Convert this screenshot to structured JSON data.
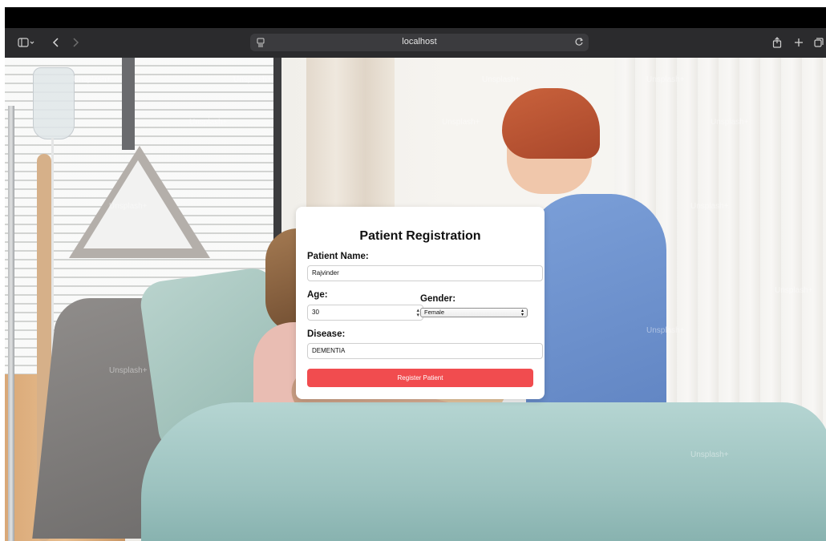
{
  "browser": {
    "url": "localhost",
    "icons": {
      "sidebar": "sidebar-icon",
      "back": "chevron-left-icon",
      "forward": "chevron-right-icon",
      "reload": "reload-icon",
      "share": "share-icon",
      "new_tab": "plus-icon",
      "tabs": "tabs-overview-icon"
    }
  },
  "background": {
    "watermark_text": "Unsplash+"
  },
  "form": {
    "title": "Patient Registration",
    "patient_name": {
      "label": "Patient Name:",
      "value": "Rajvinder"
    },
    "age": {
      "label": "Age:",
      "value": "30"
    },
    "gender": {
      "label": "Gender:",
      "selected": "Female"
    },
    "disease": {
      "label": "Disease:",
      "value": "DEMENTIA"
    },
    "submit_label": "Register Patient",
    "colors": {
      "submit_bg": "#f14c4f",
      "card_bg": "#ffffff"
    }
  }
}
